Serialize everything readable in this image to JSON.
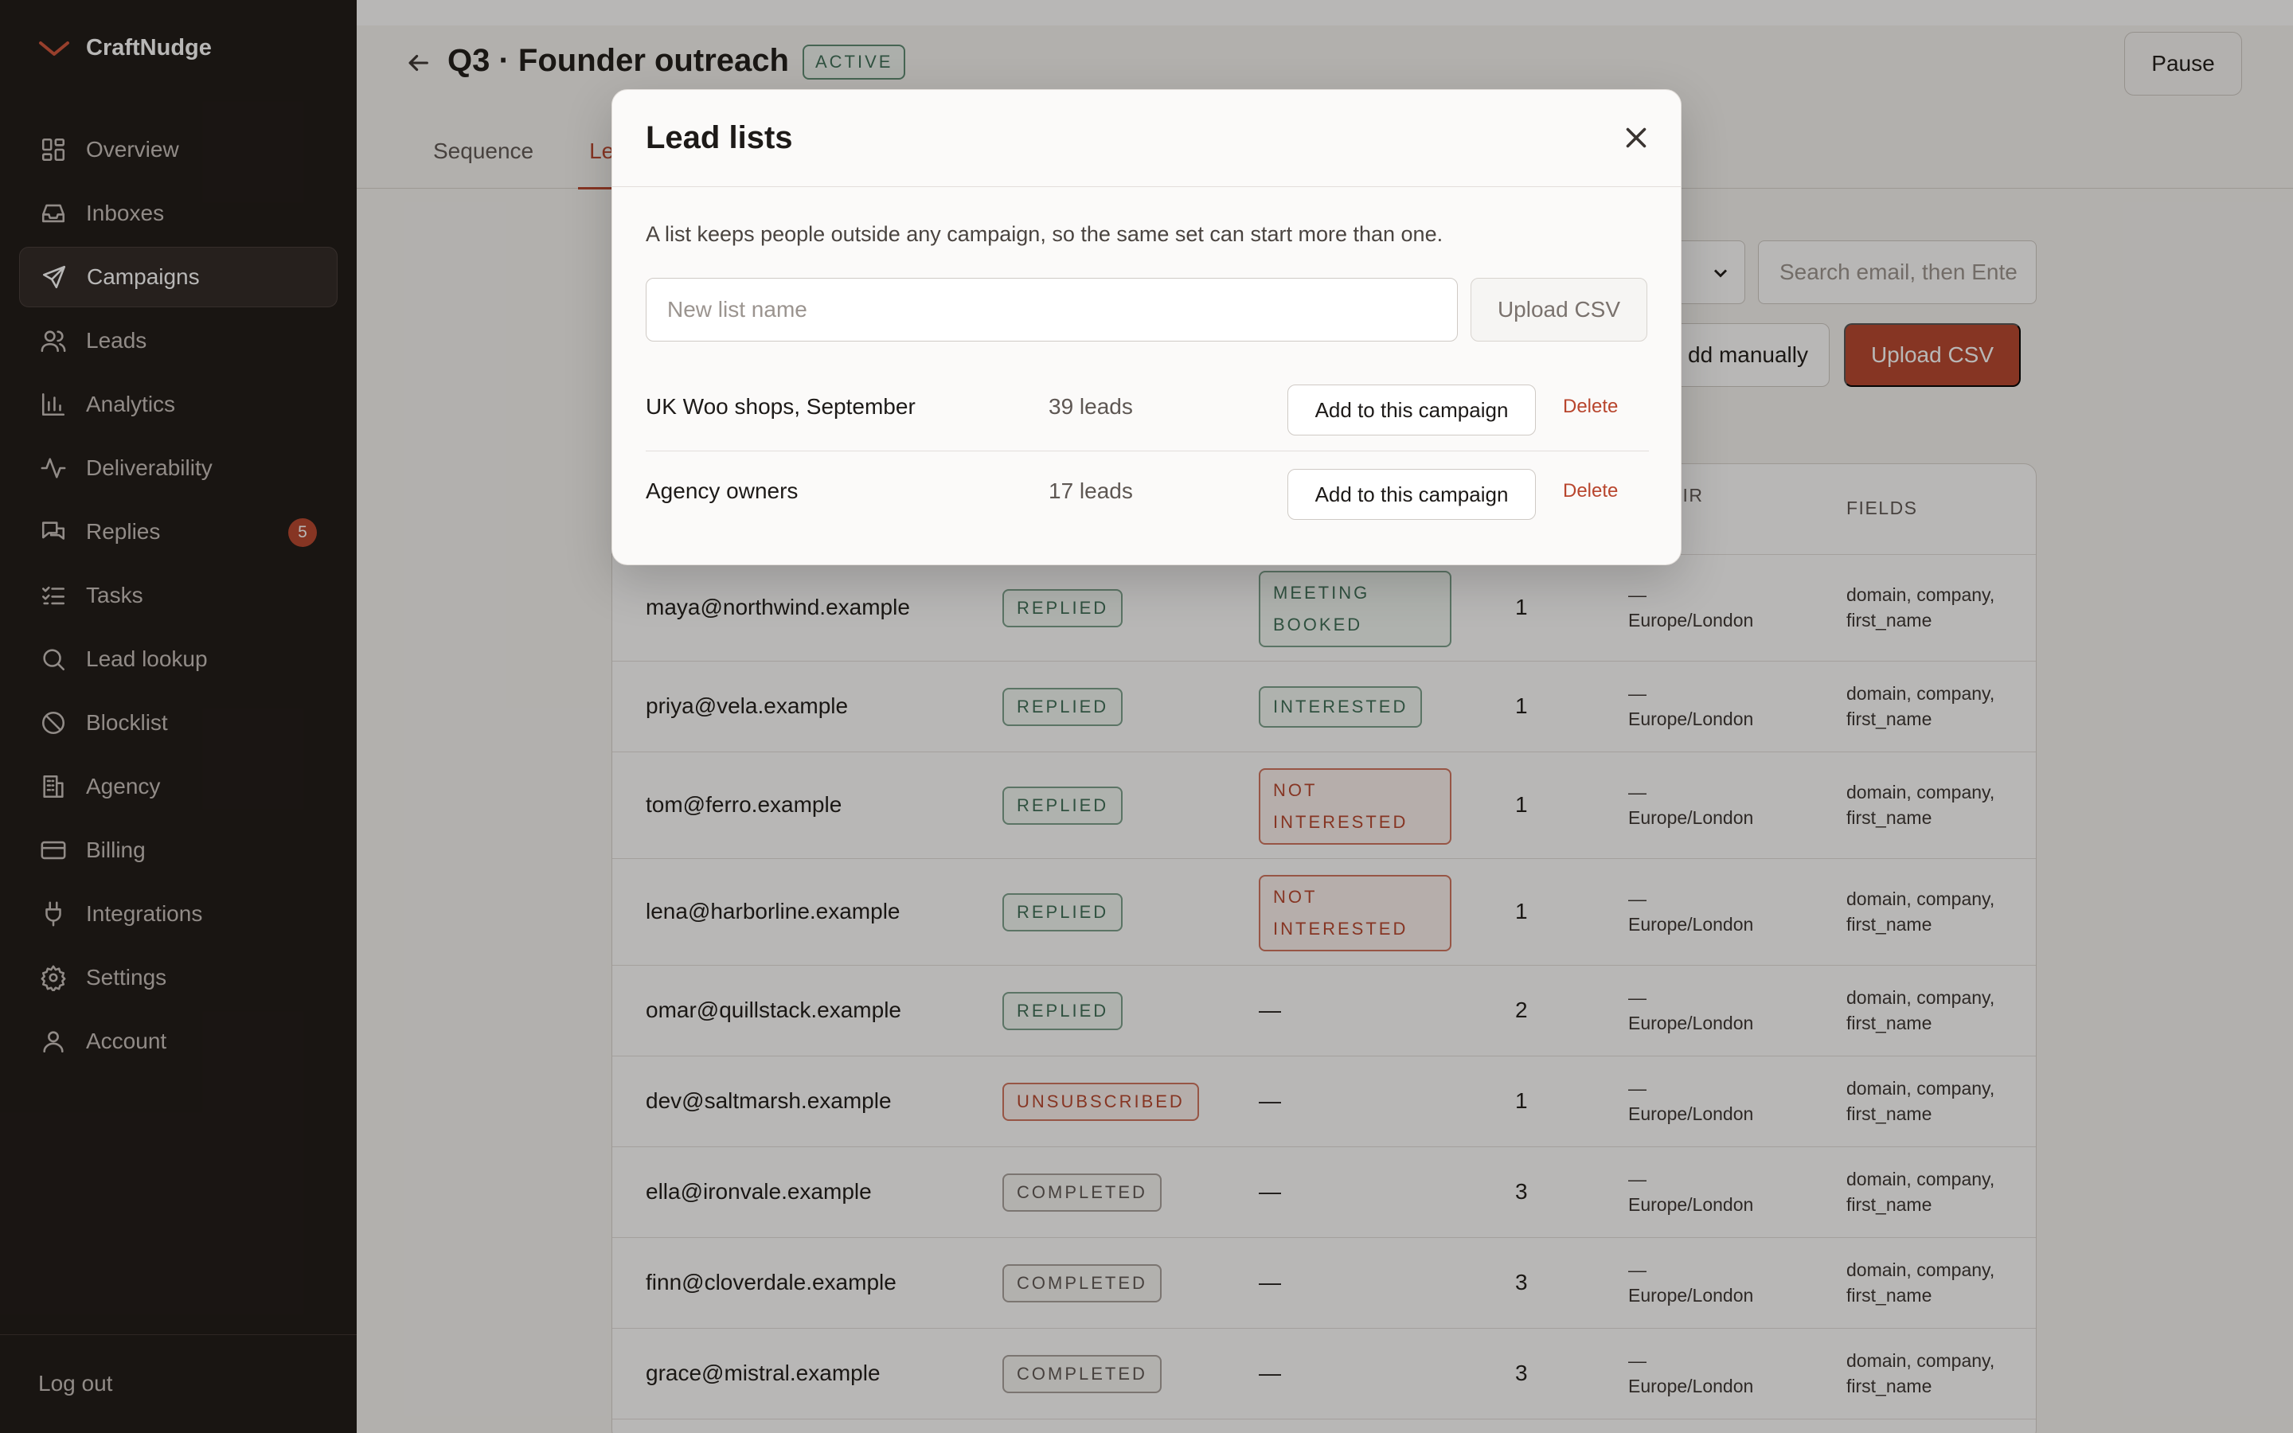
{
  "brand": {
    "name": "CraftNudge",
    "accent": "#b8452d"
  },
  "sidebar": {
    "items": [
      {
        "label": "Overview",
        "icon": "grid-icon"
      },
      {
        "label": "Inboxes",
        "icon": "inbox-icon"
      },
      {
        "label": "Campaigns",
        "icon": "send-icon",
        "active": true
      },
      {
        "label": "Leads",
        "icon": "users-icon"
      },
      {
        "label": "Analytics",
        "icon": "bar-chart-icon"
      },
      {
        "label": "Deliverability",
        "icon": "activity-icon"
      },
      {
        "label": "Replies",
        "icon": "chat-icon",
        "badge": "5"
      },
      {
        "label": "Tasks",
        "icon": "checklist-icon"
      },
      {
        "label": "Lead lookup",
        "icon": "search-icon"
      },
      {
        "label": "Blocklist",
        "icon": "ban-icon"
      },
      {
        "label": "Agency",
        "icon": "building-icon"
      },
      {
        "label": "Billing",
        "icon": "credit-card-icon"
      },
      {
        "label": "Integrations",
        "icon": "plug-icon"
      },
      {
        "label": "Settings",
        "icon": "gear-icon"
      },
      {
        "label": "Account",
        "icon": "user-icon"
      }
    ],
    "logout": "Log out"
  },
  "header": {
    "title": "Q3 · Founder outreach",
    "status": "ACTIVE",
    "pause_label": "Pause",
    "tabs": [
      {
        "label": "Sequence"
      },
      {
        "label": "Le",
        "active": true
      }
    ]
  },
  "controls": {
    "search_placeholder": "Search email, then Ente",
    "add_manually": "dd manually",
    "upload_csv": "Upload CSV"
  },
  "table": {
    "headers": {
      "their": "THEIR",
      "fields": "FIELDS"
    },
    "rows": [
      {
        "email": "maya@northwind.example",
        "status": "REPLIED",
        "intent_l1": "MEETING",
        "intent_l2": "BOOKED",
        "step": "1",
        "tz_top": "—",
        "tz": "Europe/London",
        "fields_l1": "domain, company,",
        "fields_l2": "first_name"
      },
      {
        "email": "priya@vela.example",
        "status": "REPLIED",
        "intent_l1": "INTERESTED",
        "step": "1",
        "tz_top": "—",
        "tz": "Europe/London",
        "fields_l1": "domain, company,",
        "fields_l2": "first_name"
      },
      {
        "email": "tom@ferro.example",
        "status": "REPLIED",
        "intent_l1": "NOT",
        "intent_l2": "INTERESTED",
        "step": "1",
        "tz_top": "—",
        "tz": "Europe/London",
        "fields_l1": "domain, company,",
        "fields_l2": "first_name"
      },
      {
        "email": "lena@harborline.example",
        "status": "REPLIED",
        "intent_l1": "NOT",
        "intent_l2": "INTERESTED",
        "step": "1",
        "tz_top": "—",
        "tz": "Europe/London",
        "fields_l1": "domain, company,",
        "fields_l2": "first_name"
      },
      {
        "email": "omar@quillstack.example",
        "status": "REPLIED",
        "intent_dash": "—",
        "step": "2",
        "tz_top": "—",
        "tz": "Europe/London",
        "fields_l1": "domain, company,",
        "fields_l2": "first_name"
      },
      {
        "email": "dev@saltmarsh.example",
        "status": "UNSUBSCRIBED",
        "intent_dash": "—",
        "step": "1",
        "tz_top": "—",
        "tz": "Europe/London",
        "fields_l1": "domain, company,",
        "fields_l2": "first_name"
      },
      {
        "email": "ella@ironvale.example",
        "status": "COMPLETED",
        "intent_dash": "—",
        "step": "3",
        "tz_top": "—",
        "tz": "Europe/London",
        "fields_l1": "domain, company,",
        "fields_l2": "first_name"
      },
      {
        "email": "finn@cloverdale.example",
        "status": "COMPLETED",
        "intent_dash": "—",
        "step": "3",
        "tz_top": "—",
        "tz": "Europe/London",
        "fields_l1": "domain, company,",
        "fields_l2": "first_name"
      },
      {
        "email": "grace@mistral.example",
        "status": "COMPLETED",
        "intent_dash": "—",
        "step": "3",
        "tz_top": "—",
        "tz": "Europe/London",
        "fields_l1": "domain, company,",
        "fields_l2": "first_name"
      }
    ]
  },
  "modal": {
    "title": "Lead lists",
    "description": "A list keeps people outside any campaign, so the same set can start more than one.",
    "input_placeholder": "New list name",
    "upload_label": "Upload CSV",
    "lists": [
      {
        "name": "UK Woo shops, September",
        "count": "39 leads",
        "add_label": "Add to this campaign",
        "delete_label": "Delete"
      },
      {
        "name": "Agency owners",
        "count": "17 leads",
        "add_label": "Add to this campaign",
        "delete_label": "Delete"
      }
    ]
  }
}
